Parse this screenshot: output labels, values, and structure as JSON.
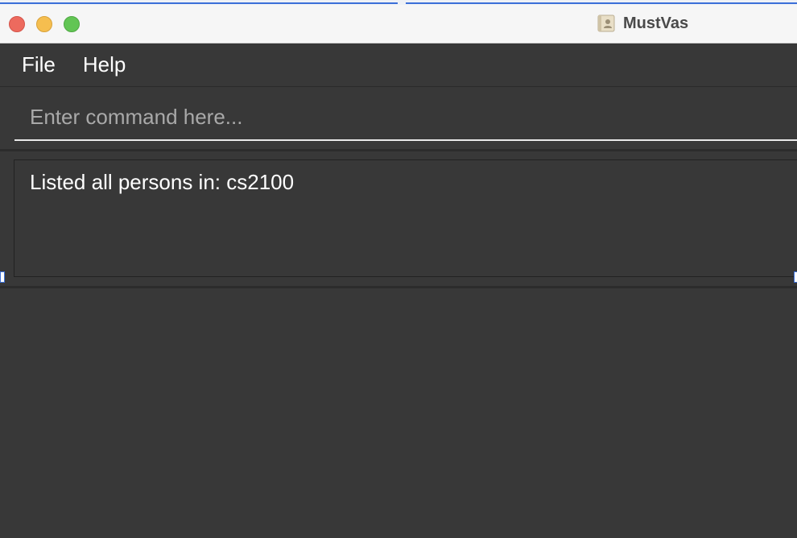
{
  "window": {
    "title": "MustVas"
  },
  "menu": {
    "items": [
      {
        "label": "File"
      },
      {
        "label": "Help"
      }
    ]
  },
  "command": {
    "value": "",
    "placeholder": "Enter command here..."
  },
  "result": {
    "message": "Listed all persons in: cs2100"
  },
  "colors": {
    "background": "#383838",
    "titlebar": "#f6f6f6",
    "close": "#ed6a5e",
    "minimize": "#f5be4f",
    "maximize": "#62c554",
    "text": "#ffffff",
    "selection": "#3b6fd8"
  },
  "icons": {
    "app": "address-book-icon"
  }
}
